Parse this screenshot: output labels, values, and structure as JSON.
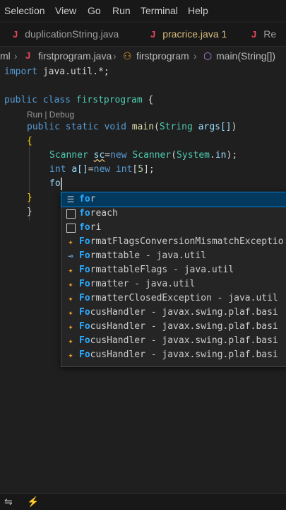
{
  "menu": [
    "Selection",
    "View",
    "Go",
    "Run",
    "Terminal",
    "Help"
  ],
  "tabs": [
    {
      "label": "duplicationString.java",
      "active": false
    },
    {
      "label": "pracrice.java 1",
      "active": false
    },
    {
      "label": "Re",
      "active": false
    }
  ],
  "breadcrumb": {
    "prefix": "ml",
    "file": "firstprogram.java",
    "class": "firstprogram",
    "method": "main(String[])"
  },
  "code": {
    "import_kw": "import",
    "import_pkg": " java.util.*;",
    "class_decl": [
      "public",
      "class",
      "firstprogram",
      "{"
    ],
    "codelens": "Run | Debug",
    "main_decl": [
      "public",
      "static",
      "void",
      "main",
      "String",
      "args[]",
      "{"
    ],
    "open_brace": "{",
    "scanner_line": [
      "Scanner",
      "sc",
      "=",
      "new",
      "Scanner",
      "System",
      "in"
    ],
    "array_line": [
      "int",
      "a[]",
      "=",
      "new",
      "int",
      "5"
    ],
    "typed": "fo",
    "close_inner": "}",
    "close_outer": "}"
  },
  "suggestions": [
    {
      "match": "fo",
      "rest": "r",
      "icon": "keyword-icon",
      "selected": true
    },
    {
      "match": "fo",
      "rest": "reach",
      "icon": "snippet-icon",
      "selected": false
    },
    {
      "match": "fo",
      "rest": "ri",
      "icon": "snippet-icon",
      "selected": false
    },
    {
      "match": "Fo",
      "rest": "rmatFlagsConversionMismatchExceptio",
      "icon": "class-icon",
      "selected": false
    },
    {
      "match": "Fo",
      "rest": "rmattable - java.util",
      "icon": "interface-icon",
      "selected": false
    },
    {
      "match": "Fo",
      "rest": "rmattableFlags - java.util",
      "icon": "class-icon",
      "selected": false
    },
    {
      "match": "Fo",
      "rest": "rmatter - java.util",
      "icon": "class-icon",
      "selected": false
    },
    {
      "match": "Fo",
      "rest": "rmatterClosedException - java.util",
      "icon": "class-icon",
      "selected": false
    },
    {
      "match": "Fo",
      "rest": "cusHandler - javax.swing.plaf.basi",
      "icon": "class-icon",
      "selected": false
    },
    {
      "match": "Fo",
      "rest": "cusHandler - javax.swing.plaf.basi",
      "icon": "class-icon",
      "selected": false
    },
    {
      "match": "Fo",
      "rest": "cusHandler - javax.swing.plaf.basi",
      "icon": "class-icon",
      "selected": false
    },
    {
      "match": "Fo",
      "rest": "cusHandler - javax.swing.plaf.basi",
      "icon": "class-icon",
      "selected": false
    }
  ],
  "colors": {
    "accent": "#007fd4",
    "match": "#2aaaff",
    "class_icon": "#ee9d28"
  },
  "status_icons": [
    "remote-icon",
    "sync-icon"
  ]
}
